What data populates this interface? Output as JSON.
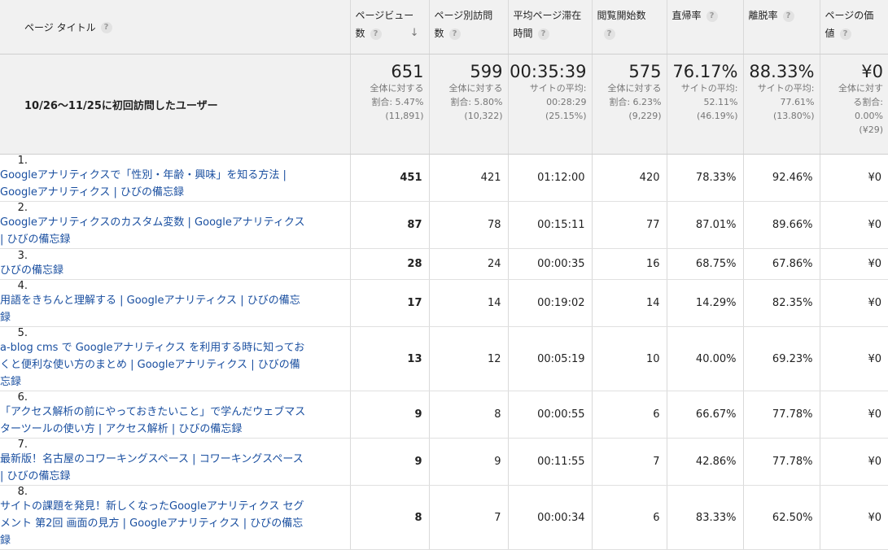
{
  "headers": {
    "title": "ページ タイトル",
    "pageviews": [
      "ページビュー",
      "数"
    ],
    "unique": [
      "ページ別訪問",
      "数"
    ],
    "avg_time": [
      "平均ページ滞在",
      "時間"
    ],
    "entrances": [
      "閲覧開始数"
    ],
    "bounce": [
      "直帰率"
    ],
    "exit": [
      "離脱率"
    ],
    "value": [
      "ページの価",
      "値"
    ],
    "help_glyph": "?",
    "sort_glyph": "↓"
  },
  "summary": {
    "segment": "10/26〜11/25に初回訪問したユーザー",
    "pageviews": {
      "value": "651",
      "l1": "全体に対する",
      "l2": "割合: 5.47%",
      "l3": "(11,891)"
    },
    "unique": {
      "value": "599",
      "l1": "全体に対する",
      "l2": "割合: 5.80%",
      "l3": "(10,322)"
    },
    "avg_time": {
      "value": "00:35:39",
      "l1": "サイトの平均:",
      "l2": "00:28:29",
      "l3": "(25.15%)"
    },
    "entrances": {
      "value": "575",
      "l1": "全体に対する",
      "l2": "割合: 6.23%",
      "l3": "(9,229)"
    },
    "bounce": {
      "value": "76.17%",
      "l1": "サイトの平均:",
      "l2": "52.11%",
      "l3": "(46.19%)"
    },
    "exit": {
      "value": "88.33%",
      "l1": "サイトの平均:",
      "l2": "77.61%",
      "l3": "(13.80%)"
    },
    "value": {
      "value": "¥0",
      "l1": "全体に対す",
      "l2": "る割合:",
      "l3": "0.00%",
      "l4": "(¥29)"
    }
  },
  "rows": [
    {
      "idx": "1.",
      "title": "Googleアナリティクスで「性別・年齢・興味」を知る方法 | Googleアナリティクス | ひびの備忘録",
      "pv": "451",
      "upv": "421",
      "time": "01:12:00",
      "ent": "420",
      "bounce": "78.33%",
      "exit": "92.46%",
      "val": "¥0"
    },
    {
      "idx": "2.",
      "title": "Googleアナリティクスのカスタム変数 | Googleアナリティクス | ひびの備忘録",
      "pv": "87",
      "upv": "78",
      "time": "00:15:11",
      "ent": "77",
      "bounce": "87.01%",
      "exit": "89.66%",
      "val": "¥0"
    },
    {
      "idx": "3.",
      "title": "ひびの備忘録",
      "pv": "28",
      "upv": "24",
      "time": "00:00:35",
      "ent": "16",
      "bounce": "68.75%",
      "exit": "67.86%",
      "val": "¥0"
    },
    {
      "idx": "4.",
      "title": "用語をきちんと理解する | Googleアナリティクス | ひびの備忘録",
      "pv": "17",
      "upv": "14",
      "time": "00:19:02",
      "ent": "14",
      "bounce": "14.29%",
      "exit": "82.35%",
      "val": "¥0"
    },
    {
      "idx": "5.",
      "title": "a-blog cms で Googleアナリティクス を利用する時に知っておくと便利な使い方のまとめ | Googleアナリティクス | ひびの備忘録",
      "pv": "13",
      "upv": "12",
      "time": "00:05:19",
      "ent": "10",
      "bounce": "40.00%",
      "exit": "69.23%",
      "val": "¥0"
    },
    {
      "idx": "6.",
      "title": "「アクセス解析の前にやっておきたいこと」で学んだウェブマスターツールの使い方 | アクセス解析 | ひびの備忘録",
      "pv": "9",
      "upv": "8",
      "time": "00:00:55",
      "ent": "6",
      "bounce": "66.67%",
      "exit": "77.78%",
      "val": "¥0"
    },
    {
      "idx": "7.",
      "title": "最新版！名古屋のコワーキングスペース | コワーキングスペース | ひびの備忘録",
      "pv": "9",
      "upv": "9",
      "time": "00:11:55",
      "ent": "7",
      "bounce": "42.86%",
      "exit": "77.78%",
      "val": "¥0"
    },
    {
      "idx": "8.",
      "title": "サイトの課題を発見！新しくなったGoogleアナリティクス セグメント 第2回 画面の見方 | Googleアナリティクス | ひびの備忘録",
      "pv": "8",
      "upv": "7",
      "time": "00:00:34",
      "ent": "6",
      "bounce": "83.33%",
      "exit": "62.50%",
      "val": "¥0"
    }
  ]
}
